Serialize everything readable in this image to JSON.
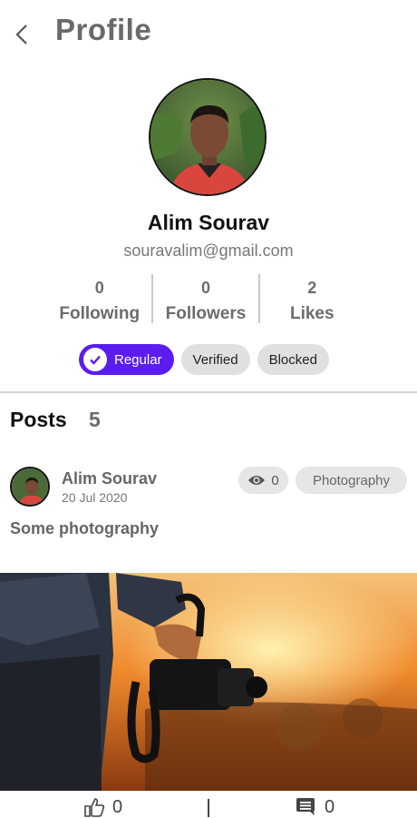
{
  "header": {
    "title": "Profile",
    "back_icon": "chevron-left-icon"
  },
  "profile": {
    "name": "Alim Sourav",
    "email": "souravalim@gmail.com",
    "stats": [
      {
        "value": "0",
        "label": "Following"
      },
      {
        "value": "0",
        "label": "Followers"
      },
      {
        "value": "2",
        "label": "Likes"
      }
    ],
    "statuses": [
      {
        "label": "Regular",
        "selected": true,
        "icon": "check-circle-icon"
      },
      {
        "label": "Verified",
        "selected": false
      },
      {
        "label": "Blocked",
        "selected": false
      }
    ],
    "accent_color": "#5b1cf0"
  },
  "posts_section": {
    "title": "Posts",
    "count": "5"
  },
  "post": {
    "author": "Alim Sourav",
    "date": "20 Jul 2020",
    "views": "0",
    "views_icon": "eye-icon",
    "category": "Photography",
    "caption": "Some photography",
    "likes": "0",
    "likes_icon": "thumbs-up-icon",
    "comments": "0",
    "comments_icon": "comment-icon"
  }
}
